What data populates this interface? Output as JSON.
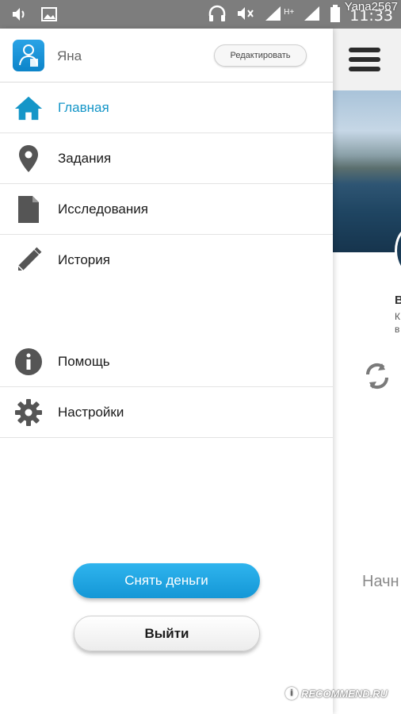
{
  "status_bar": {
    "time": "11:33",
    "network": "H+",
    "icons": [
      "volume-icon",
      "image-icon",
      "headset-icon",
      "mute-icon",
      "signal-icon",
      "signal-icon",
      "battery-icon"
    ]
  },
  "watermark_user": "Yana2567",
  "profile": {
    "name": "Яна",
    "edit_label": "Редактировать"
  },
  "menu": {
    "items": [
      {
        "label": "Главная",
        "icon": "home-icon",
        "active": true
      },
      {
        "label": "Задания",
        "icon": "location-pin-icon"
      },
      {
        "label": "Исследования",
        "icon": "document-icon"
      },
      {
        "label": "История",
        "icon": "pencil-icon"
      },
      {
        "label": "Помощь",
        "icon": "info-icon"
      },
      {
        "label": "Настройки",
        "icon": "gear-icon"
      }
    ]
  },
  "buttons": {
    "withdraw_label": "Снять деньги",
    "logout_label": "Выйти"
  },
  "background_app": {
    "title_letter": "В",
    "line1": "К",
    "line2": "в",
    "partial_text": "Начн"
  },
  "watermark": {
    "mark": "i",
    "text": "RECOMMEND.RU"
  },
  "colors": {
    "accent": "#1596c8",
    "status_bar": "#7d7d7d",
    "button_blue": "#1497d6"
  }
}
